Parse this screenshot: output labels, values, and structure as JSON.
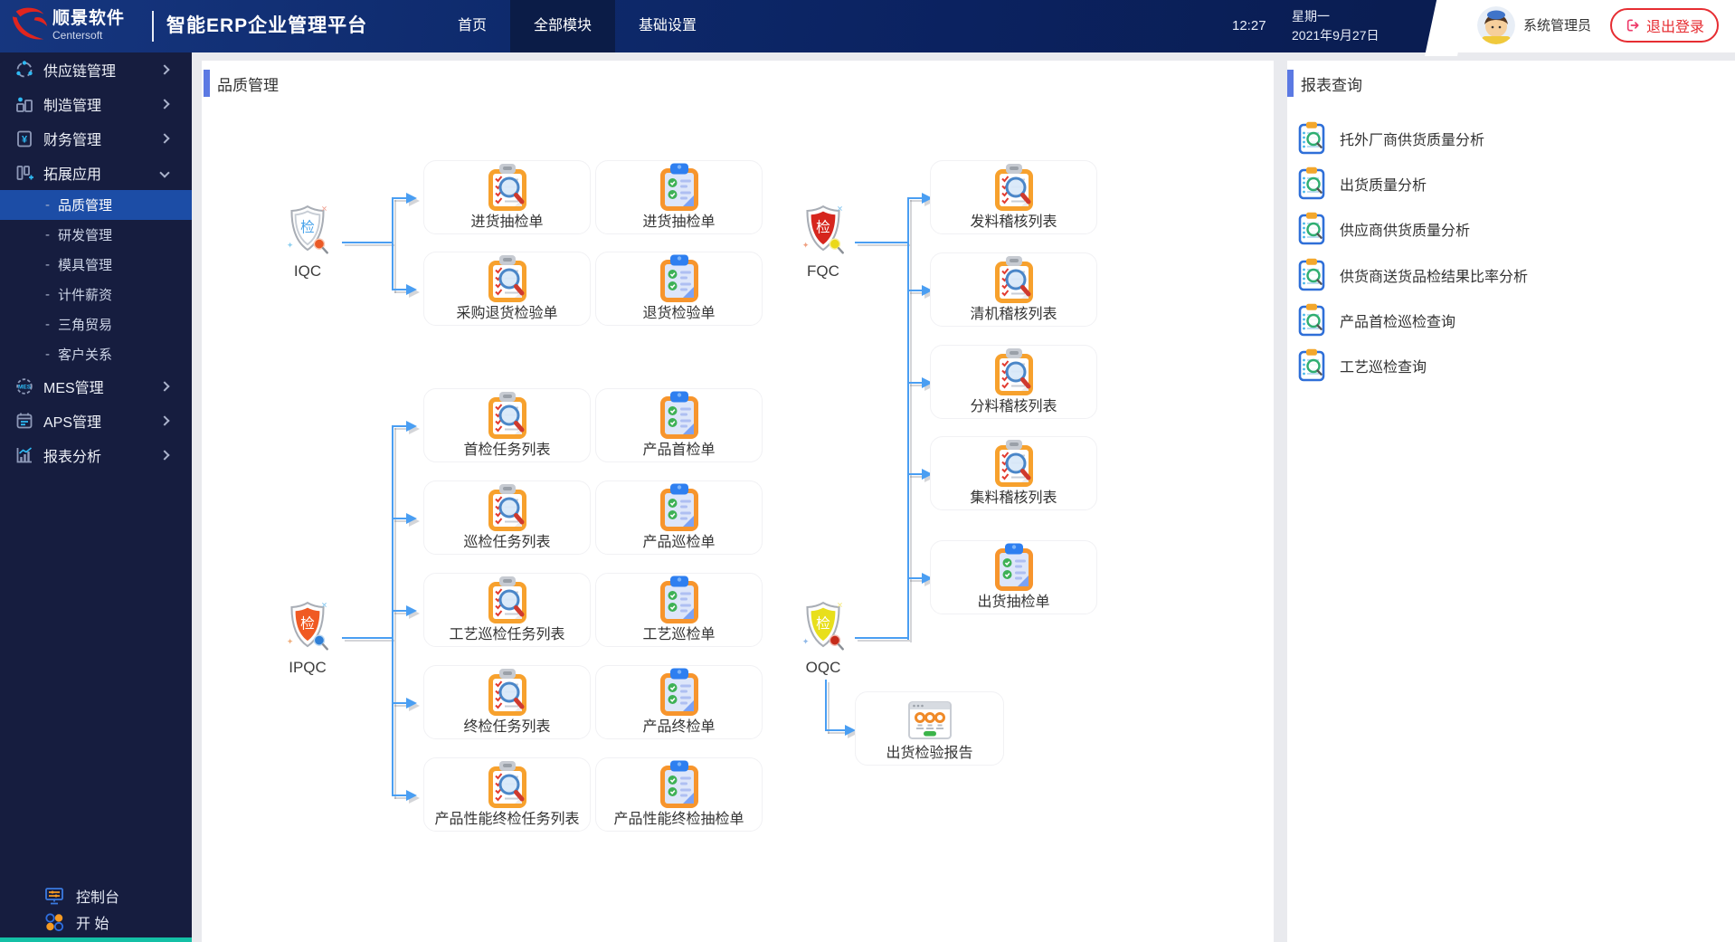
{
  "colors": {
    "topbar_navy": "#0e2a6c",
    "sidebar_navy": "#161d3f",
    "active_menu_blue": "#1c4da6",
    "accent_blue": "#5b79e3",
    "connector_blue": "#4a9ef2",
    "logout_red": "#e62d32",
    "clipboard_orange": "#f7a12d",
    "shield_red": "#d6261e",
    "shield_orange": "#f05a23",
    "shield_yellow": "#e8df1c"
  },
  "icons": {
    "task_node": "clipboard-magnifier-icon",
    "form_node": "clipboard-checklist-icon",
    "report_node": "report-window-icon",
    "iqc": "shield-check-white-icon",
    "fqc": "shield-check-red-icon",
    "ipqc": "shield-check-orange-icon",
    "oqc": "shield-check-yellow-icon",
    "report_list": "clipboard-search-blue-icon"
  },
  "topbar": {
    "logo_name": "顺景软件",
    "logo_sub": "Centersoft",
    "app_title": "智能ERP企业管理平台",
    "nav": [
      {
        "label": "首页"
      },
      {
        "label": "全部模块"
      },
      {
        "label": "基础设置"
      }
    ],
    "time": "12:27",
    "weekday": "星期一",
    "date": "2021年9月27日",
    "username": "系统管理员",
    "logout_label": "退出登录"
  },
  "sidebar": {
    "sub_prefix": "-",
    "items": [
      {
        "label": "供应链管理"
      },
      {
        "label": "制造管理"
      },
      {
        "label": "财务管理"
      },
      {
        "label": "拓展应用"
      },
      {
        "label": "MES管理"
      },
      {
        "label": "APS管理"
      },
      {
        "label": "报表分析"
      }
    ],
    "subitems": [
      {
        "label": "品质管理"
      },
      {
        "label": "研发管理"
      },
      {
        "label": "模具管理"
      },
      {
        "label": "计件薪资"
      },
      {
        "label": "三角贸易"
      },
      {
        "label": "客户关系"
      }
    ],
    "console_label": "控制台",
    "start_label": "开 始"
  },
  "main": {
    "title": "品质管理",
    "groups": {
      "iqc": "IQC",
      "ipqc": "IPQC",
      "fqc": "FQC",
      "oqc": "OQC"
    },
    "iqc_tasks": [
      "进货抽检单",
      "采购退货检验单"
    ],
    "iqc_forms": [
      "进货抽检单",
      "退货检验单"
    ],
    "ipqc_tasks": [
      "首检任务列表",
      "巡检任务列表",
      "工艺巡检任务列表",
      "终检任务列表",
      "产品性能终检任务列表"
    ],
    "ipqc_forms": [
      "产品首检单",
      "产品巡检单",
      "工艺巡检单",
      "产品终检单",
      "产品性能终检抽检单"
    ],
    "fqc_lists": [
      "发料稽核列表",
      "清机稽核列表",
      "分料稽核列表",
      "集料稽核列表"
    ],
    "oqc_items": [
      "出货抽检单",
      "出货检验报告"
    ]
  },
  "reports": {
    "title": "报表查询",
    "items": [
      "托外厂商供货质量分析",
      "出货质量分析",
      "供应商供货质量分析",
      "供货商送货品检结果比率分析",
      "产品首检巡检查询",
      "工艺巡检查询"
    ]
  }
}
